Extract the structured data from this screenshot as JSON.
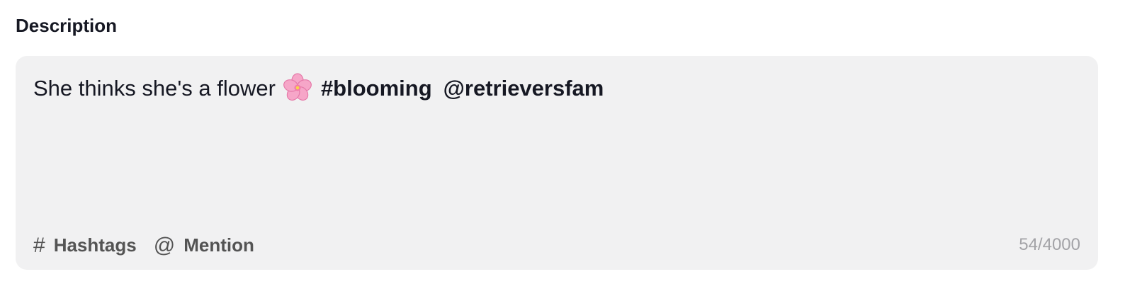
{
  "field": {
    "label": "Description"
  },
  "editor": {
    "text_before_emoji": "She thinks she's a flower",
    "emoji_icon": "cherry-blossom-icon",
    "hashtag": "#blooming",
    "mention": "@retrieversfam"
  },
  "toolbar": {
    "hashtags_glyph": "#",
    "hashtags_label": "Hashtags",
    "mention_glyph": "@",
    "mention_label": "Mention"
  },
  "counter": {
    "text": "54/4000"
  },
  "colors": {
    "editor_bg": "#f1f1f2",
    "text": "#161823",
    "toolbar_text": "#545454",
    "counter_text": "#a3a3a7"
  }
}
